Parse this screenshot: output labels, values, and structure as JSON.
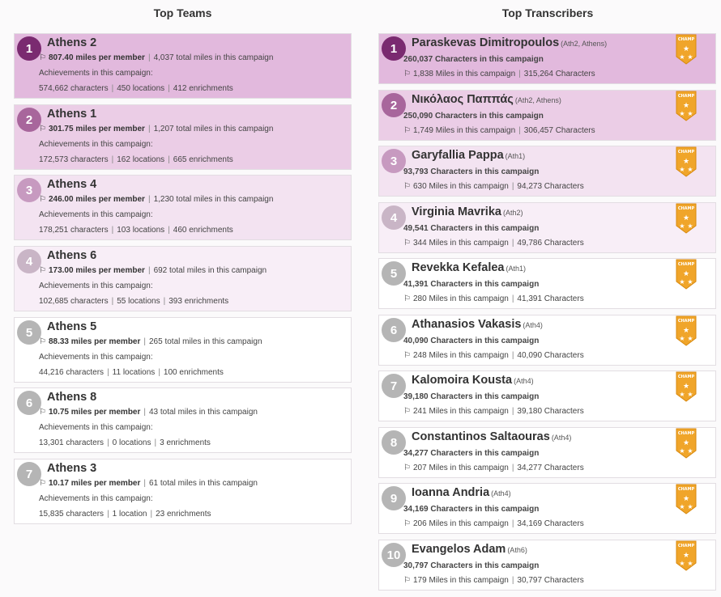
{
  "headings": {
    "teams": "Top Teams",
    "transcribers": "Top Transcribers"
  },
  "labels": {
    "miles_per_member": "miles per member",
    "total_miles": "total miles in this campaign",
    "achievements": "Achievements in this campaign:",
    "characters": "characters",
    "enrichments": "enrichments",
    "chars_in_campaign": "Characters in this campaign",
    "miles_in_campaign": "Miles in this campaign",
    "characters_cap": "Characters",
    "champ": "CHAMP"
  },
  "colors": {
    "rank1_bg": "#e2b9dd",
    "rank2_bg": "#ebcde6",
    "rank3_bg": "#f3e3f1",
    "rank4_bg": "#f8eef7",
    "plain_bg": "#ffffff",
    "rank1_circle": "#7a2a70",
    "rank2_circle": "#a8669c",
    "rank3_circle": "#c79ac0",
    "rank4_circle": "#c9b5c6",
    "rank_other_circle": "#b5b5b5",
    "badge": "#f0a52a"
  },
  "teams": [
    {
      "rank": "1",
      "name": "Athens 2",
      "mpm": "807.40",
      "total": "4,037",
      "chars": "574,662",
      "locations": "450 locations",
      "enrich": "412"
    },
    {
      "rank": "2",
      "name": "Athens 1",
      "mpm": "301.75",
      "total": "1,207",
      "chars": "172,573",
      "locations": "162 locations",
      "enrich": "665"
    },
    {
      "rank": "3",
      "name": "Athens 4",
      "mpm": "246.00",
      "total": "1,230",
      "chars": "178,251",
      "locations": "103 locations",
      "enrich": "460"
    },
    {
      "rank": "4",
      "name": "Athens 6",
      "mpm": "173.00",
      "total": "692",
      "chars": "102,685",
      "locations": "55 locations",
      "enrich": "393"
    },
    {
      "rank": "5",
      "name": "Athens 5",
      "mpm": "88.33",
      "total": "265",
      "chars": "44,216",
      "locations": "11 locations",
      "enrich": "100"
    },
    {
      "rank": "6",
      "name": "Athens 8",
      "mpm": "10.75",
      "total": "43",
      "chars": "13,301",
      "locations": "0 locations",
      "enrich": "3"
    },
    {
      "rank": "7",
      "name": "Athens 3",
      "mpm": "10.17",
      "total": "61",
      "chars": "15,835",
      "locations": "1 location",
      "enrich": "23"
    }
  ],
  "transcribers": [
    {
      "rank": "1",
      "name": "Paraskevas Dimitropoulos",
      "team": "(Ath2, Athens)",
      "chars": "260,037",
      "miles": "1,838",
      "total_chars": "315,264"
    },
    {
      "rank": "2",
      "name": "Νικόλαος Παππάς",
      "team": "(Ath2, Athens)",
      "chars": "250,090",
      "miles": "1,749",
      "total_chars": "306,457"
    },
    {
      "rank": "3",
      "name": "Garyfallia Pappa",
      "team": "(Ath1)",
      "chars": "93,793",
      "miles": "630",
      "total_chars": "94,273"
    },
    {
      "rank": "4",
      "name": "Virginia Mavrika",
      "team": "(Ath2)",
      "chars": "49,541",
      "miles": "344",
      "total_chars": "49,786"
    },
    {
      "rank": "5",
      "name": "Revekka Kefalea",
      "team": "(Ath1)",
      "chars": "41,391",
      "miles": "280",
      "total_chars": "41,391"
    },
    {
      "rank": "6",
      "name": "Athanasios Vakasis",
      "team": "(Ath4)",
      "chars": "40,090",
      "miles": "248",
      "total_chars": "40,090"
    },
    {
      "rank": "7",
      "name": "Kalomoira Kousta",
      "team": "(Ath4)",
      "chars": "39,180",
      "miles": "241",
      "total_chars": "39,180"
    },
    {
      "rank": "8",
      "name": "Constantinos Saltaouras",
      "team": "(Ath4)",
      "chars": "34,277",
      "miles": "207",
      "total_chars": "34,277"
    },
    {
      "rank": "9",
      "name": "Ioanna Andria",
      "team": "(Ath4)",
      "chars": "34,169",
      "miles": "206",
      "total_chars": "34,169"
    },
    {
      "rank": "10",
      "name": "Evangelos Adam",
      "team": "(Ath6)",
      "chars": "30,797",
      "miles": "179",
      "total_chars": "30,797"
    }
  ]
}
